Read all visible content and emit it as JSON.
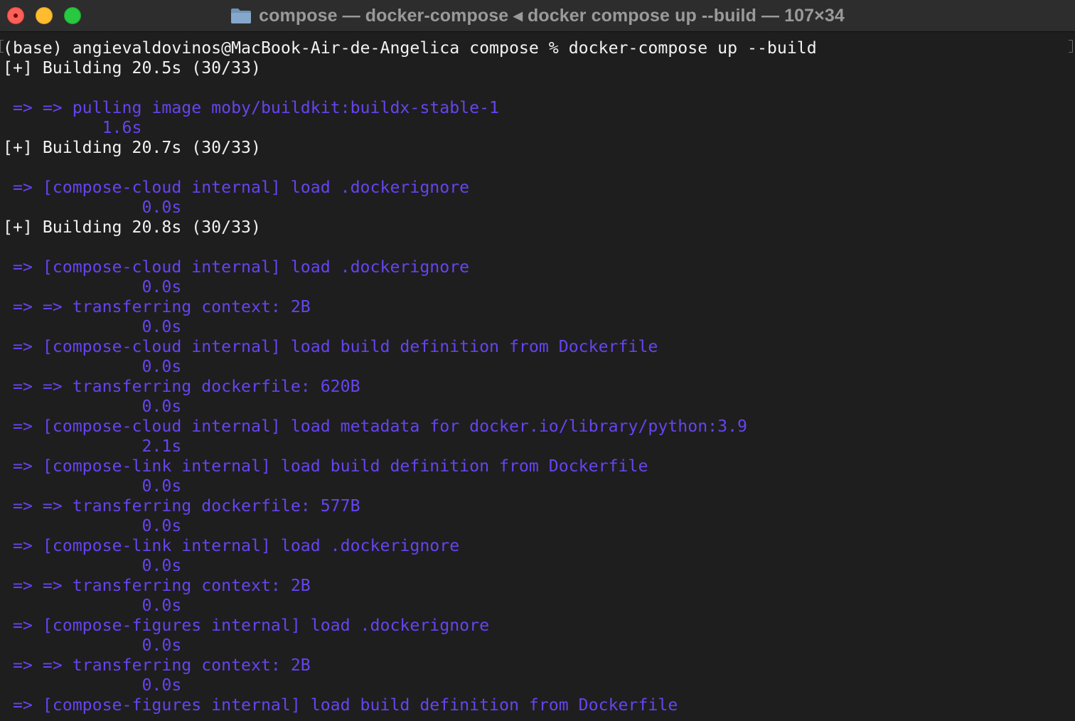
{
  "window": {
    "title": "compose — docker-compose ◂ docker compose up --build — 107×34",
    "colors": {
      "background": "#1e1e1e",
      "titlebar": "#2d2d2d",
      "output_text": "#6644f0",
      "prompt_text": "#f2f2f2",
      "close": "#fe5f57",
      "minimize": "#febc2e",
      "zoom": "#28c840"
    },
    "icons": [
      "close-icon",
      "minimize-icon",
      "zoom-icon",
      "folder-icon"
    ]
  },
  "terminal": {
    "lines": [
      {
        "text": "(base) angievaldovinos@MacBook-Air-de-Angelica compose % docker-compose up --build",
        "kind": "prompt"
      },
      {
        "text": "[+] Building 20.5s (30/33)",
        "kind": "status"
      },
      {
        "text": "",
        "kind": "blank"
      },
      {
        "text": " => => pulling image moby/buildkit:buildx-stable-1",
        "kind": "output"
      },
      {
        "text": "          1.6s",
        "kind": "output"
      },
      {
        "text": "[+] Building 20.7s (30/33)",
        "kind": "status"
      },
      {
        "text": "",
        "kind": "blank"
      },
      {
        "text": " => [compose-cloud internal] load .dockerignore",
        "kind": "output"
      },
      {
        "text": "              0.0s",
        "kind": "output"
      },
      {
        "text": "[+] Building 20.8s (30/33)",
        "kind": "status"
      },
      {
        "text": "",
        "kind": "blank"
      },
      {
        "text": " => [compose-cloud internal] load .dockerignore",
        "kind": "output"
      },
      {
        "text": "              0.0s",
        "kind": "output"
      },
      {
        "text": " => => transferring context: 2B",
        "kind": "output"
      },
      {
        "text": "              0.0s",
        "kind": "output"
      },
      {
        "text": " => [compose-cloud internal] load build definition from Dockerfile",
        "kind": "output"
      },
      {
        "text": "              0.0s",
        "kind": "output"
      },
      {
        "text": " => => transferring dockerfile: 620B",
        "kind": "output"
      },
      {
        "text": "              0.0s",
        "kind": "output"
      },
      {
        "text": " => [compose-cloud internal] load metadata for docker.io/library/python:3.9",
        "kind": "output"
      },
      {
        "text": "              2.1s",
        "kind": "output"
      },
      {
        "text": " => [compose-link internal] load build definition from Dockerfile",
        "kind": "output"
      },
      {
        "text": "              0.0s",
        "kind": "output"
      },
      {
        "text": " => => transferring dockerfile: 577B",
        "kind": "output"
      },
      {
        "text": "              0.0s",
        "kind": "output"
      },
      {
        "text": " => [compose-link internal] load .dockerignore",
        "kind": "output"
      },
      {
        "text": "              0.0s",
        "kind": "output"
      },
      {
        "text": " => => transferring context: 2B",
        "kind": "output"
      },
      {
        "text": "              0.0s",
        "kind": "output"
      },
      {
        "text": " => [compose-figures internal] load .dockerignore",
        "kind": "output"
      },
      {
        "text": "              0.0s",
        "kind": "output"
      },
      {
        "text": " => => transferring context: 2B",
        "kind": "output"
      },
      {
        "text": "              0.0s",
        "kind": "output"
      },
      {
        "text": " => [compose-figures internal] load build definition from Dockerfile",
        "kind": "output"
      }
    ]
  }
}
